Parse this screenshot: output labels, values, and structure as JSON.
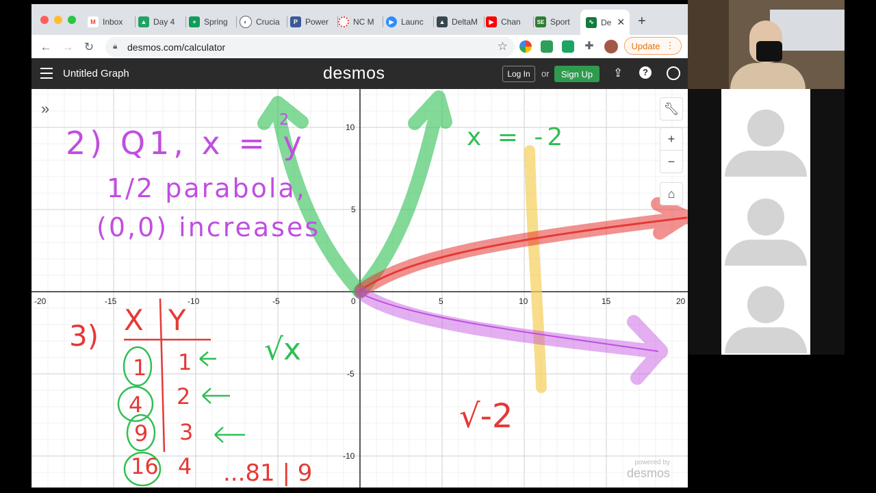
{
  "browser": {
    "tabs": [
      {
        "label": "Inbox",
        "icon": "gmail-icon",
        "color": "#ea4335"
      },
      {
        "label": "Day 4",
        "icon": "google-drive-icon",
        "color": "#1fa463"
      },
      {
        "label": "Spring",
        "icon": "green-plus-icon",
        "color": "#0f9d58"
      },
      {
        "label": "Crucia",
        "icon": "half-circle-icon",
        "color": "#5f6368"
      },
      {
        "label": "Power",
        "icon": "p-icon",
        "color": "#3b5998"
      },
      {
        "label": "NC M",
        "icon": "ring-icon",
        "color": "#e53935"
      },
      {
        "label": "Launc",
        "icon": "zoom-icon",
        "color": "#2d8cff"
      },
      {
        "label": "DeltaM",
        "icon": "mortarboard-icon",
        "color": "#37474f"
      },
      {
        "label": "Chan",
        "icon": "youtube-icon",
        "color": "#ff0000"
      },
      {
        "label": "Sport",
        "icon": "se-icon",
        "color": "#2e7d32"
      },
      {
        "label": "De",
        "icon": "desmos-icon",
        "color": "#127a3d",
        "active": true
      }
    ],
    "new_tab": "+",
    "url": "desmos.com/calculator",
    "update_label": "Update"
  },
  "desmos": {
    "graph_title": "Untitled Graph",
    "logo": "desmos",
    "login_label": "Log In",
    "or_label": "or",
    "signup_label": "Sign Up",
    "powered_by": "powered by",
    "powered_logo": "desmos",
    "x_ticks": [
      "-20",
      "-15",
      "-10",
      "-5",
      "0",
      "5",
      "10",
      "15",
      "20"
    ],
    "y_ticks": [
      "10",
      "5",
      "-5",
      "-10"
    ]
  },
  "annotations": {
    "q2_line1": "2) Q1, x = y",
    "q2_exp": "2",
    "q2_line2": "1/2 parabola,",
    "q2_line3": "(0,0) increases",
    "x_eq": "x = -2",
    "q3_label": "3)",
    "table_x": "X",
    "table_y": "Y",
    "table_rows": [
      {
        "x": "1",
        "y": "1"
      },
      {
        "x": "4",
        "y": "2"
      },
      {
        "x": "9",
        "y": "3"
      },
      {
        "x": "16",
        "y": "4"
      }
    ],
    "table_more": "...81 | 9",
    "sqrt_x": "√x",
    "sqrt_neg2": "√-2"
  },
  "colors": {
    "red": "#e53935",
    "green": "#2fbf54",
    "purple": "#c04ee0",
    "yellow": "#f5cf5a",
    "desmos_green": "#2f9b4f"
  }
}
